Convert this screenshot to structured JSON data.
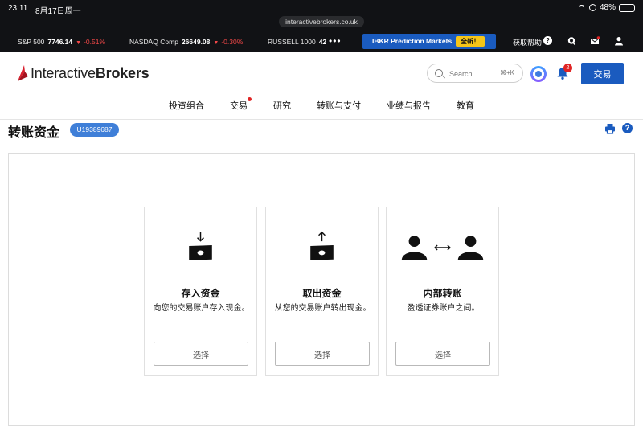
{
  "status_bar": {
    "time": "23:11",
    "date": "8月17日周一",
    "battery": "48%",
    "battery_level": 0.48,
    "url": "interactivebrokers.co.uk"
  },
  "ticker": {
    "items": [
      {
        "name": "S&P 500",
        "value": "7746.14",
        "change": "-0.51%"
      },
      {
        "name": "NASDAQ Comp",
        "value": "26649.08",
        "change": "-0.30%"
      },
      {
        "name": "RUSSELL 1000",
        "value": "42"
      }
    ],
    "more": "•••",
    "promo_label": "IBKR Prediction Markets",
    "promo_badge": "全新！",
    "help_label": "获取帮助",
    "help_glyph": "?"
  },
  "header": {
    "logo_light": "Interactive",
    "logo_bold": "Brokers",
    "search_placeholder": "Search",
    "search_shortcut": "⌘+K",
    "notification_count": "2",
    "trade_button": "交易",
    "nav": [
      "投资组合",
      "交易",
      "研究",
      "转账与支付",
      "业绩与报告",
      "教育"
    ]
  },
  "page": {
    "title": "转账资金",
    "account_id": "U19389687",
    "help_glyph": "?"
  },
  "cards": [
    {
      "title": "存入资金",
      "desc": "向您的交易账户存入现金。",
      "button": "选择",
      "icon": "deposit-icon"
    },
    {
      "title": "取出资金",
      "desc": "从您的交易账户转出现金。",
      "button": "选择",
      "icon": "withdraw-icon"
    },
    {
      "title": "内部转账",
      "desc": "盈透证券账户之间。",
      "button": "选择",
      "icon": "internal-transfer-icon"
    }
  ],
  "colors": {
    "brand_blue": "#1a5bbf",
    "ticker_bg": "#111215",
    "down_red": "#f04848",
    "badge_yellow": "#f5c518",
    "logo_red": "#d81e2c"
  }
}
